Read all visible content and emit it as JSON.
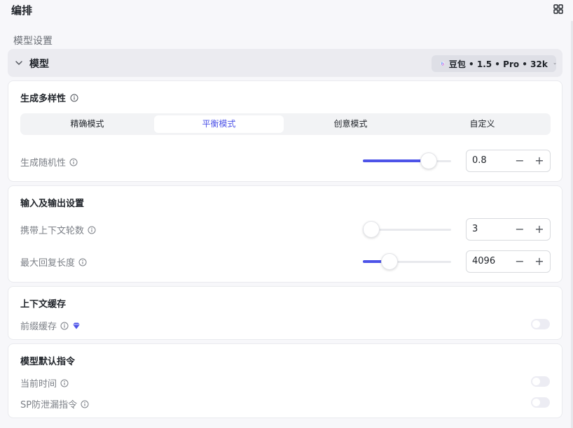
{
  "header": {
    "title": "编排"
  },
  "section_label": "模型设置",
  "model": {
    "label": "模型",
    "selected": "豆包 • 1.5 • Pro • 32k"
  },
  "diversity": {
    "title": "生成多样性",
    "modes": [
      "精确模式",
      "平衡模式",
      "创意模式",
      "自定义"
    ],
    "active_mode": "平衡模式",
    "randomness_label": "生成随机性",
    "randomness_value": "0.8",
    "randomness_fraction": 0.8
  },
  "io": {
    "title": "输入及输出设置",
    "context_rounds_label": "携带上下文轮数",
    "context_rounds_value": "3",
    "context_rounds_fraction": 0.0,
    "max_reply_label": "最大回复长度",
    "max_reply_value": "4096",
    "max_reply_fraction": 0.25
  },
  "cache": {
    "title": "上下文缓存",
    "prefix_label": "前缀缓存",
    "prefix_enabled": false
  },
  "instructions": {
    "title": "模型默认指令",
    "time_label": "当前时间",
    "time_enabled": false,
    "sp_label": "SP防泄漏指令",
    "sp_enabled": false
  },
  "stepper": {
    "minus": "−",
    "plus": "+"
  },
  "colors": {
    "accent": "#4d53e8",
    "toggle_off": "#ececf3"
  }
}
